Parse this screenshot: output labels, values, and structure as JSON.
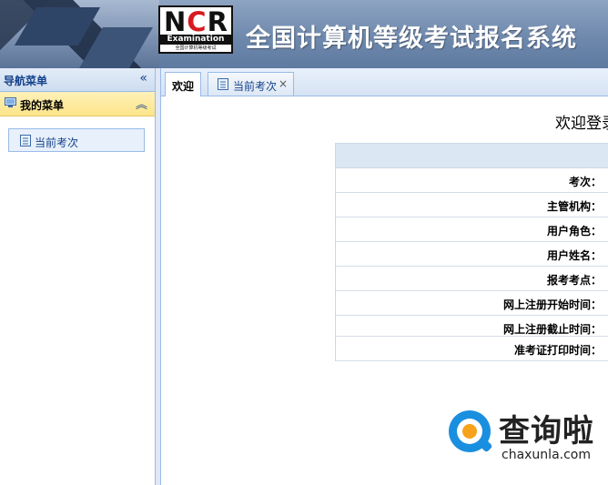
{
  "header": {
    "logo_letters": "NCR",
    "logo_examination": "Examination",
    "logo_sub": "全国计算机等级考试",
    "title": "全国计算机等级考试报名系统"
  },
  "nav": {
    "title": "导航菜单",
    "section_title": "我的菜单",
    "items": [
      {
        "label": "当前考次",
        "icon": "doc-icon"
      }
    ],
    "collapse_icon": "double-chevron-left",
    "toggle_icon": "double-chevron-up"
  },
  "tabs": [
    {
      "label": "欢迎",
      "active": true
    },
    {
      "label": "当前考次",
      "active": false,
      "closable": true
    }
  ],
  "main": {
    "welcome_text": "欢迎登录",
    "info_rows": [
      {
        "label": "考次："
      },
      {
        "label": "主管机构："
      },
      {
        "label": "用户角色："
      },
      {
        "label": "用户姓名："
      },
      {
        "label": "报考考点："
      },
      {
        "label": "网上注册开始时间："
      },
      {
        "label": "网上注册截止时间："
      },
      {
        "label": "准考证打印时间："
      }
    ]
  },
  "watermark": {
    "name": "查询啦",
    "url": "chaxunla.com"
  },
  "colors": {
    "header_blue": "#6f89ad",
    "nav_title": "#15428b",
    "menu_yellow": "#fde58a",
    "border": "#99bbe8"
  }
}
